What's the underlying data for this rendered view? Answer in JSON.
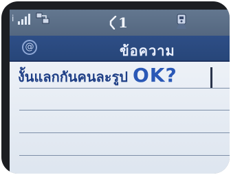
{
  "status_bar": {
    "signal_glyph": "i",
    "line_indicator": "1",
    "icons": [
      "signal-bars-icon",
      "network-icon",
      "line-1-icon",
      "phone-icon"
    ]
  },
  "header": {
    "icon": "at-icon",
    "title": "ข้อความ"
  },
  "message": {
    "text_thai": "งั้นแลกกันคนละรูป ",
    "text_latin": "OK?"
  },
  "colors": {
    "status_bar": "#5f7390",
    "title_bar": "#2b4a80",
    "content_bg": "#e6ecf4",
    "message_text": "#1f3f86",
    "rule_line": "#7d8ea8"
  }
}
